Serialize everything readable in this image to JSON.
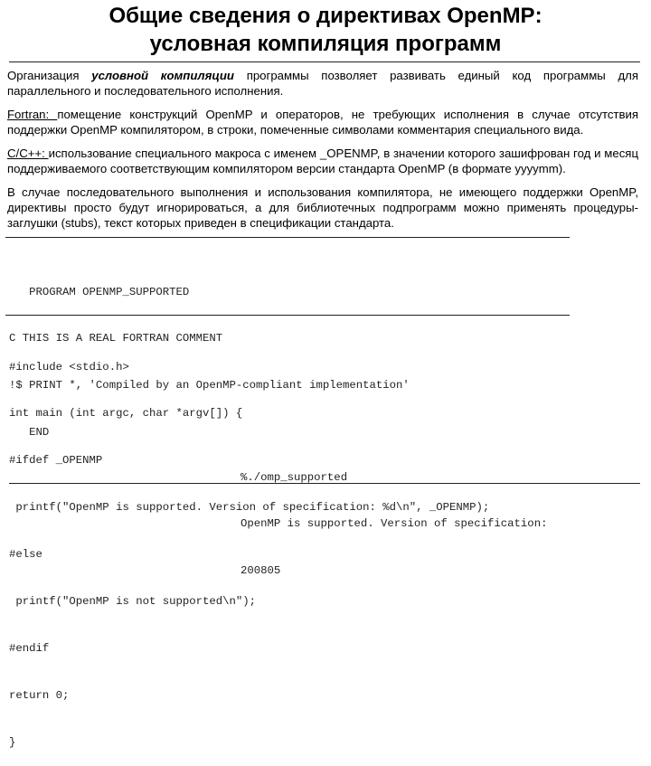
{
  "title": {
    "line1": "Общие сведения о директивах OpenMP:",
    "line2": "условная компиляция программ"
  },
  "paragraphs": {
    "intro": {
      "prefix": "Организация ",
      "emphasis": "условной компиляции",
      "suffix": " программы позволяет развивать единый код программы для параллельного и последовательного исполнения."
    },
    "fortran": {
      "label": "Fortran: ",
      "text": "помещение конструкций OpenMP и операторов, не требующих исполнения в случае отсутствия поддержки OpenMP компилятором, в строки, помеченные символами комментария специального вида."
    },
    "cpp": {
      "label": "C/C++: ",
      "text": "использование специального макроса с именем _OPENMP, в значении которого зашифрован год и месяц поддерживаемого соответствующим компилятором версии стандарта OpenMP (в формате yyyymm)."
    },
    "sequential": {
      "text": "В случае последовательного выполнения и использования компилятора, не имеющего поддержки OpenMP, директивы просто будут игнорироваться, а для библиотечных подпрограмм можно применять процедуры-заглушки (stubs), текст которых приведен в спецификации стандарта."
    }
  },
  "fortran_code": [
    "   PROGRAM OPENMP_SUPPORTED",
    "C THIS IS A REAL FORTRAN COMMENT",
    "!$ PRINT *, 'Compiled by an OpenMP-compliant implementation'",
    "   END"
  ],
  "c_code": [
    "#include <stdio.h>",
    "int main (int argc, char *argv[]) {",
    "#ifdef _OPENMP",
    " printf(\"OpenMP is supported. Version of specification: %d\\n\", _OPENMP);",
    "#else",
    " printf(\"OpenMP is not supported\\n\");",
    "#endif",
    "return 0;",
    "}"
  ],
  "console_output": [
    "%./omp_supported",
    "OpenMP is supported. Version of specification:",
    "200805"
  ]
}
